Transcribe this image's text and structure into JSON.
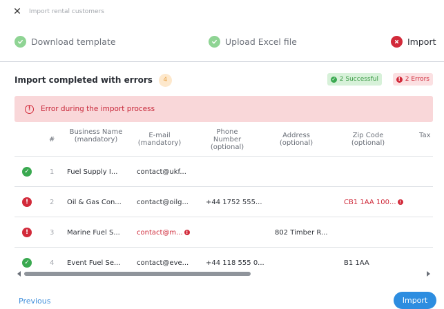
{
  "dialog": {
    "title": "Import rental customers",
    "close_icon": "close-icon"
  },
  "steps": [
    {
      "label": "Download template",
      "status": "done"
    },
    {
      "label": "Upload Excel file",
      "status": "done"
    },
    {
      "label": "Import",
      "status": "error"
    }
  ],
  "summary": {
    "title": "Import completed with errors",
    "count": "4",
    "successful_label": "2 Successful",
    "errors_label": "2 Errors"
  },
  "alert": {
    "text": "Error during the import process"
  },
  "table": {
    "headers": {
      "index": "#",
      "business": "Business Name (mandatory)",
      "email": "E-mail (mandatory)",
      "phone": "Phone Number (optional)",
      "address": "Address (optional)",
      "zip": "Zip Code (optional)",
      "tax": "Tax (opt"
    },
    "rows": [
      {
        "status": "success",
        "index": "1",
        "business": "Fuel Supply I...",
        "email": "contact@ukf...",
        "phone": "",
        "address": "",
        "zip": "",
        "tax": ""
      },
      {
        "status": "error",
        "index": "2",
        "business": "Oil & Gas Con...",
        "email": "contact@oilg...",
        "phone": "+44 1752 555...",
        "address": "",
        "zip": "CB1 1AA 100...",
        "tax": ""
      },
      {
        "status": "error",
        "index": "3",
        "business": "Marine Fuel S...",
        "email": "contact@m...",
        "phone": "",
        "address": "802 Timber R...",
        "zip": "",
        "tax": ""
      },
      {
        "status": "success",
        "index": "4",
        "business": "Event Fuel Se...",
        "email": "contact@eve...",
        "phone": "+44 118 555 0...",
        "address": "",
        "zip": "B1 1AA",
        "tax": ""
      }
    ]
  },
  "footer": {
    "previous_label": "Previous",
    "import_label": "Import"
  },
  "colors": {
    "success": "#3aa950",
    "error": "#d22a3a",
    "accent": "#2d8de0",
    "warning_badge": "#fde8cc"
  }
}
